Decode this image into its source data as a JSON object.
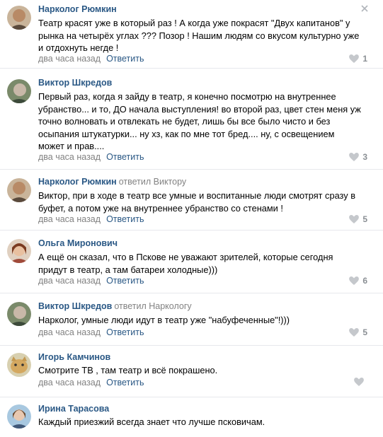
{
  "comments": [
    {
      "author": "Нарколог Рюмкин",
      "reply_to": "",
      "lines": [
        "Театр красят уже в который раз ! А когда уже покрасят \"Двух капитанов\" у",
        "рынка на четырёх углах ??? Позор ! Нашим людям со вкусом культурно уже",
        "и отдохнуть негде !"
      ],
      "time": "два часа назад",
      "reply_label": "Ответить",
      "likes": "1"
    },
    {
      "author": "Виктор Шкредов",
      "reply_to": "",
      "lines": [
        "Первый раз, когда я зайду в театр, я конечно посмотрю на внутреннее",
        "убранство... и то, ДО начала выступления! во второй раз, цвет стен меня уж",
        "точно волновать и отвлекать не будет, лишь бы все было чисто и без",
        "осыпания штукатурки... ну хз, как по мне тот бред.... ну, с освещением",
        "может и прав...."
      ],
      "time": "два часа назад",
      "reply_label": "Ответить",
      "likes": "3"
    },
    {
      "author": "Нарколог Рюмкин",
      "reply_to": "ответил Виктору",
      "lines": [
        "Виктор, при в ходе в театр все умные и воспитанные люди смотрят сразу в",
        "буфет, а потом уже на внутреннее убранство со стенами !"
      ],
      "time": "два часа назад",
      "reply_label": "Ответить",
      "likes": "5"
    },
    {
      "author": "Ольга Миронович",
      "reply_to": "",
      "lines": [
        "А ещё он сказал, что в Пскове не уважают зрителей, которые сегодня",
        "придут в театр, а там батареи холодные)))"
      ],
      "time": "два часа назад",
      "reply_label": "Ответить",
      "likes": "6"
    },
    {
      "author": "Виктор Шкредов",
      "reply_to": "ответил Наркологу",
      "lines": [
        "Нарколог, умные люди идут в театр уже \"набуфеченные\"!)))"
      ],
      "time": "два часа назад",
      "reply_label": "Ответить",
      "likes": "5"
    },
    {
      "author": "Игорь Камчинов",
      "reply_to": "",
      "lines": [
        "Смотрите ТВ , там театр и всё покрашено."
      ],
      "time": "два часа назад",
      "reply_label": "Ответить",
      "likes": ""
    },
    {
      "author": "Ирина Тарасова",
      "reply_to": "",
      "lines": [
        "Каждый приезжий всегда знает что лучше псковичам."
      ],
      "time": "",
      "reply_label": "",
      "likes": ""
    }
  ],
  "icons": {
    "like": "heart-icon",
    "close": "close-icon"
  },
  "colors": {
    "author": "#2a5885",
    "meta": "#828282",
    "divider": "#e7e8ec"
  }
}
